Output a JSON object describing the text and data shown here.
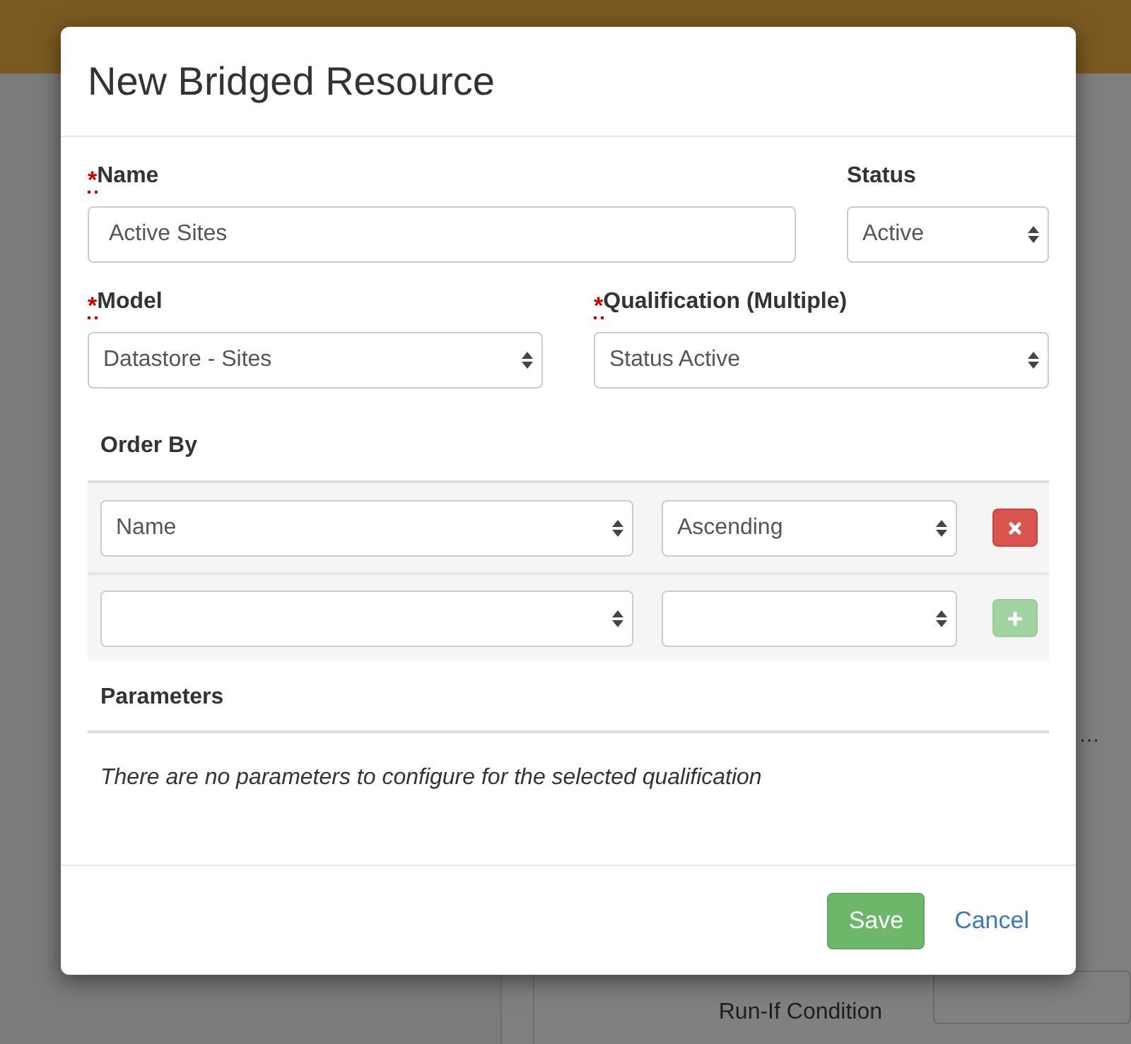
{
  "dialog": {
    "title": "New Bridged Resource",
    "fields": [
      {
        "marker": "*",
        "label": "Name",
        "kind": "text",
        "value": "Active Sites"
      },
      {
        "label": "Status",
        "kind": "select",
        "value": "Active"
      },
      {
        "marker": "*",
        "label": "Model",
        "kind": "select",
        "value": "Datastore - Sites"
      },
      {
        "marker": "*",
        "label": "Qualification (Multiple)",
        "kind": "select",
        "value": "Status Active"
      }
    ],
    "order_by": {
      "heading": "Order By",
      "rows": [
        {
          "field": "Name",
          "direction": "Ascending",
          "button": {
            "kind": "remove",
            "disabled": false
          }
        },
        {
          "button": {
            "kind": "add",
            "disabled": true
          }
        }
      ]
    },
    "parameters": {
      "heading": "Parameters",
      "message": "There are no parameters to configure for the selected qualification"
    },
    "buttons": [
      {
        "label": "Save",
        "kind": "primary"
      },
      {
        "label": "Cancel",
        "kind": "link"
      }
    ]
  },
  "background": {
    "ellipsis": "…",
    "label": "Run-If Condition"
  }
}
